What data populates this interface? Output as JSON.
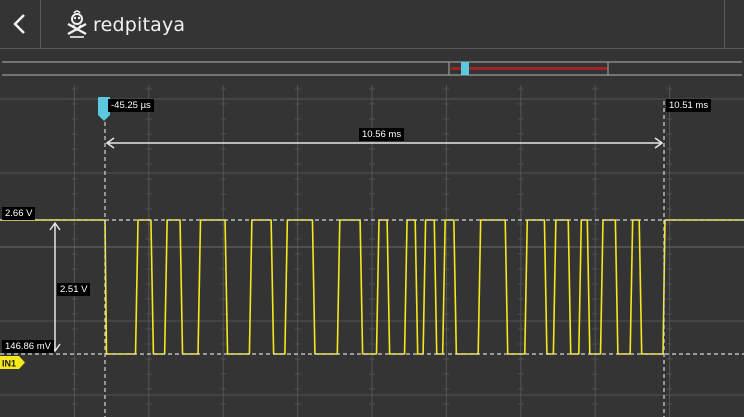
{
  "header": {
    "back_icon": "chevron-left-icon",
    "logo_text": "redpitaya",
    "logo_icon": "redpitaya-mascot-icon"
  },
  "colors": {
    "background": "#343434",
    "signal": "#f5e81c",
    "cursor_marker": "#5cc8e0",
    "nav_window": "#a02424",
    "label_bg": "#000000"
  },
  "cursors": {
    "x1_label": "-45.25 µs",
    "x2_label": "10.51 ms",
    "dx_label": "10.56 ms",
    "y1_label": "2.66 V",
    "y2_label": "146.86 mV",
    "dy_label": "2.51 V"
  },
  "channel": {
    "label": "IN1"
  },
  "signal": {
    "high_v": 2.66,
    "low_v": 0.14686,
    "initial_level": "high",
    "start_ms": -0.04525,
    "end_ms": 10.51,
    "pulses_ms": [
      [
        0.55,
        0.85
      ],
      [
        1.1,
        1.4
      ],
      [
        1.73,
        2.25
      ],
      [
        2.7,
        3.12
      ],
      [
        3.37,
        3.9
      ],
      [
        4.36,
        4.8
      ],
      [
        5.1,
        5.31
      ],
      [
        5.63,
        5.84
      ],
      [
        5.98,
        6.2
      ],
      [
        6.35,
        6.57
      ],
      [
        7.02,
        7.54
      ],
      [
        7.9,
        8.28
      ],
      [
        8.44,
        8.73
      ],
      [
        8.92,
        9.09
      ],
      [
        9.33,
        9.62
      ],
      [
        9.89,
        10.07
      ]
    ]
  }
}
